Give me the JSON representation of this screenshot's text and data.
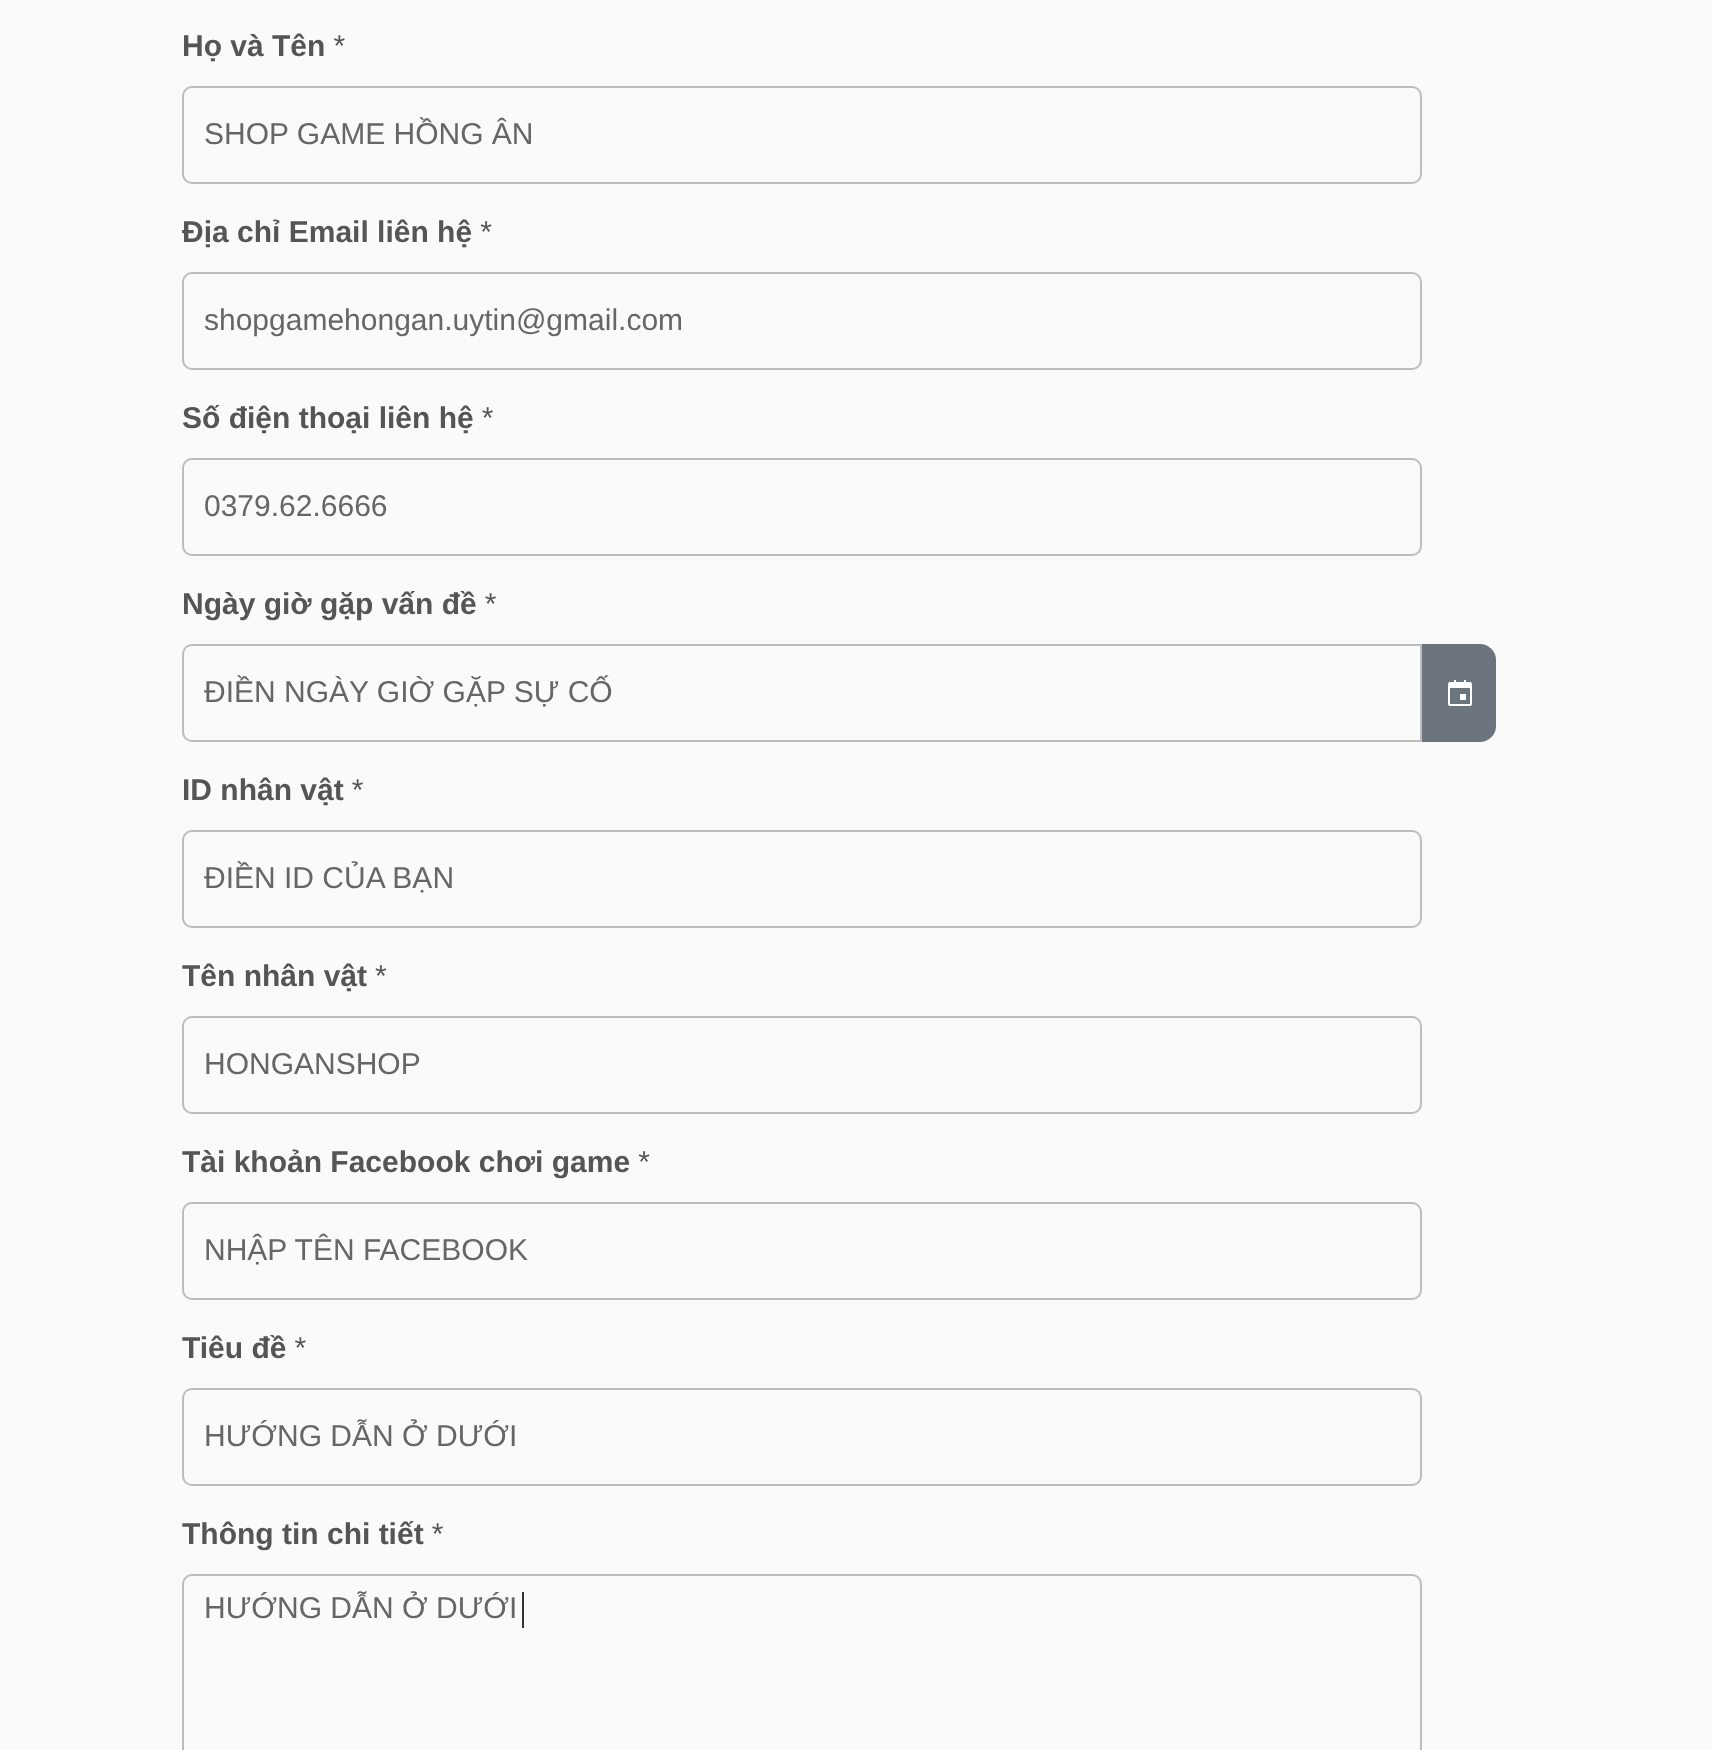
{
  "fields": [
    {
      "label": "Họ và Tên",
      "required": "*",
      "kind": "text",
      "value": "SHOP GAME HỒNG ÂN"
    },
    {
      "label": "Địa chỉ Email liên hệ",
      "required": "*",
      "kind": "text",
      "value": "shopgamehongan.uytin@gmail.com"
    },
    {
      "label": "Số điện thoại liên hệ",
      "required": "*",
      "kind": "text",
      "value": "0379.62.6666"
    },
    {
      "label": "Ngày giờ gặp vấn đề",
      "required": "*",
      "kind": "date",
      "value": "ĐIỀN NGÀY GIỜ GẶP SỰ CỐ"
    },
    {
      "label": "ID nhân vật",
      "required": "*",
      "kind": "text",
      "value": "ĐIỀN ID CỦA BẠN"
    },
    {
      "label": "Tên nhân vật",
      "required": "*",
      "kind": "text",
      "value": "HONGANSHOP"
    },
    {
      "label": "Tài khoản Facebook chơi game",
      "required": "*",
      "kind": "text",
      "value": "NHẬP TÊN FACEBOOK"
    },
    {
      "label": "Tiêu đề",
      "required": "*",
      "kind": "text",
      "value": "HƯỚNG DẪN Ở DƯỚI"
    },
    {
      "label": "Thông tin chi tiết",
      "required": "*",
      "kind": "textarea",
      "value": "HƯỚNG DẪN Ở DƯỚI"
    }
  ]
}
